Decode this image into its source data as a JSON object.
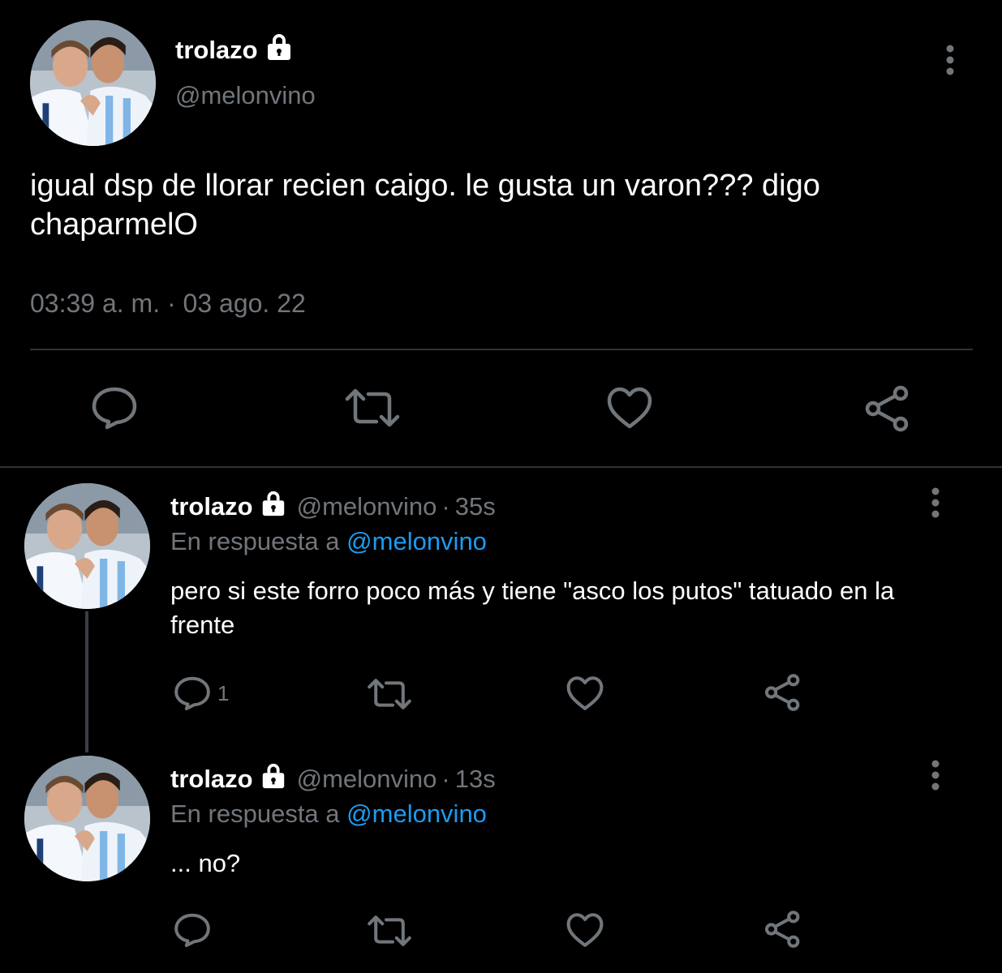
{
  "main_tweet": {
    "display_name": "trolazo",
    "handle": "@melonvino",
    "text": "igual dsp de llorar recien caigo. le gusta un varon??? digo chaparmelO",
    "timestamp": "03:39 a. m. · 03 ago. 22",
    "icons": [
      "lock-icon",
      "more-vertical-icon",
      "reply-icon",
      "retweet-icon",
      "like-icon",
      "share-icon"
    ]
  },
  "replies": [
    {
      "display_name": "trolazo",
      "handle": "@melonvino",
      "separator": "·",
      "time": "35s",
      "reply_prefix": "En respuesta a",
      "reply_mention": "@melonvino",
      "text": "pero si este forro poco más y tiene \"asco los putos\" tatuado en la frente",
      "reply_count": "1"
    },
    {
      "display_name": "trolazo",
      "handle": "@melonvino",
      "separator": "·",
      "time": "13s",
      "reply_prefix": "En respuesta a",
      "reply_mention": "@melonvino",
      "text": "... no?",
      "reply_count": ""
    }
  ],
  "colors": {
    "background": "#000000",
    "text_primary": "#ffffff",
    "text_secondary": "#71767b",
    "link": "#1d9bf0",
    "divider": "#2f3336"
  }
}
